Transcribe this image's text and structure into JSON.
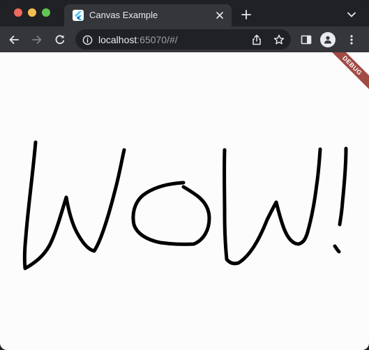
{
  "window": {
    "tab": {
      "title": "Canvas Example",
      "favicon": "flutter-logo-icon"
    },
    "toolbar": {
      "url_host": "localhost",
      "url_rest": ":65070/#/"
    }
  },
  "app": {
    "debug_banner": "DEBUG",
    "drawing_description_color": "#000000"
  },
  "colors": {
    "chrome_dark": "#202124",
    "chrome_toolbar": "#35363a",
    "canvas_bg": "#fcfcfc",
    "debug_banner": "#a04b44",
    "stroke": "#000000"
  }
}
